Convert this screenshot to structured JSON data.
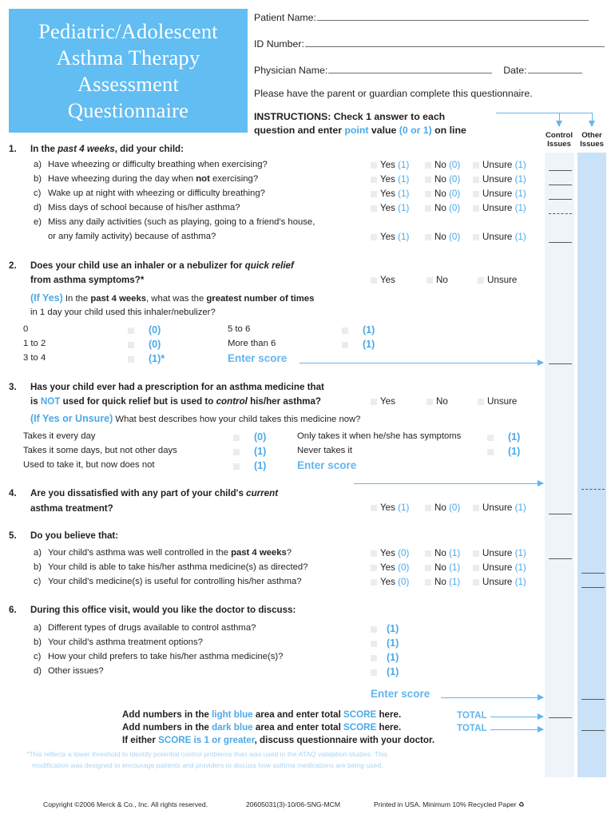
{
  "title_banner": {
    "lines": [
      "Pediatric/Adolescent",
      "Asthma Therapy",
      "Assessment",
      "Questionnaire"
    ],
    "bg_color": "#61bdf2"
  },
  "header": {
    "patient_name_label": "Patient Name:",
    "id_number_label": "ID Number:",
    "physician_name_label": "Physician Name:",
    "date_label": "Date:",
    "parent_note": "Please have the parent or guardian complete this questionnaire.",
    "instructions_line1_a": "INSTRUCTIONS:  Check 1 answer to each",
    "instructions_line2_a": "question and enter ",
    "instructions_point": "point",
    "instructions_line2_b": " value ",
    "instructions_range": "(0 or 1)",
    "instructions_line2_c": " on line"
  },
  "columns": {
    "control_issues": "Control\nIssues",
    "control_issues_l1": "Control",
    "control_issues_l2": "Issues",
    "other_issues_l1": "Other",
    "other_issues_l2": "Issues",
    "control_color": "#eef4f9",
    "other_color": "#c9e2f7"
  },
  "answers": {
    "yes": "Yes",
    "no": "No",
    "unsure": "Unsure",
    "p1": "(1)",
    "p0": "(0)"
  },
  "q1": {
    "number": "1.",
    "stem_a": "In the ",
    "stem_i": "past 4 weeks",
    "stem_b": ", did your child:",
    "items": [
      {
        "letter": "a)",
        "text_pre": "Have wheezing or difficulty breathing when exercising?",
        "yes": "(1)",
        "no": "(0)",
        "unsure": "(1)"
      },
      {
        "letter": "b)",
        "text_pre": "Have wheezing during the day when ",
        "bold": "not",
        "text_post": " exercising?",
        "yes": "(1)",
        "no": "(0)",
        "unsure": "(1)"
      },
      {
        "letter": "c)",
        "text_pre": "Wake up at night with wheezing or difficulty breathing?",
        "yes": "(1)",
        "no": "(0)",
        "unsure": "(1)"
      },
      {
        "letter": "d)",
        "text_pre": "Miss days of school because of his/her asthma?",
        "yes": "(1)",
        "no": "(0)",
        "unsure": "(1)"
      },
      {
        "letter": "e)",
        "text_pre": "Miss any daily activities (such as playing, going to a friend's house,",
        "line2": "or any family activity) because of asthma?",
        "yes": "(1)",
        "no": "(0)",
        "unsure": "(1)"
      }
    ]
  },
  "q2": {
    "number": "2.",
    "line1_a": "Does your child use an inhaler or a nebulizer for ",
    "line1_i": "quick relief",
    "line2": "from asthma symptoms?*",
    "if_yes": "(If Yes)",
    "sub_a": " In the ",
    "sub_b": "past 4 weeks",
    "sub_c": ", what was the ",
    "sub_d": "greatest number of times",
    "sub_line2": "in 1 day your child used this inhaler/nebulizer?",
    "options_left": [
      {
        "label": "0",
        "value": "(0)"
      },
      {
        "label": "1 to 2",
        "value": "(0)"
      },
      {
        "label": "3 to 4",
        "value": "(1)*"
      }
    ],
    "options_right": [
      {
        "label": "5 to 6",
        "value": "(1)"
      },
      {
        "label": "More than 6",
        "value": "(1)"
      }
    ],
    "enter_score": "Enter score"
  },
  "q3": {
    "number": "3.",
    "line1": "Has your child ever had a prescription for an asthma medicine that",
    "line2_a": "is ",
    "line2_not": "NOT",
    "line2_b": " used for quick relief but is used to ",
    "line2_i": "control",
    "line2_c": " his/her asthma?",
    "if_yes_unsure": "(If Yes or Unsure)",
    "sub": " What best describes how your child takes this medicine now?",
    "options_left": [
      {
        "label": "Takes it every day",
        "value": "(0)"
      },
      {
        "label": "Takes it some days, but not other days",
        "value": "(1)"
      },
      {
        "label": "Used to take it, but now does not",
        "value": "(1)"
      }
    ],
    "options_right": [
      {
        "label": "Only takes it when he/she has symptoms",
        "value": "(1)"
      },
      {
        "label": "Never takes it",
        "value": "(1)"
      }
    ],
    "enter_score": "Enter score"
  },
  "q4": {
    "number": "4.",
    "line1_a": "Are you dissatisfied with any part of your child's ",
    "line1_i": "current",
    "line2": "asthma treatment?",
    "yes": "(1)",
    "no": "(0)",
    "unsure": "(1)"
  },
  "q5": {
    "number": "5.",
    "stem": "Do you believe that:",
    "items": [
      {
        "letter": "a)",
        "text_pre": "Your child's asthma was well controlled in the ",
        "bold": "past 4 weeks",
        "text_post": "?",
        "yes": "(0)",
        "no": "(1)",
        "unsure": "(1)"
      },
      {
        "letter": "b)",
        "text_pre": "Your child is able to take his/her asthma medicine(s) as directed?",
        "yes": "(0)",
        "no": "(1)",
        "unsure": "(1)"
      },
      {
        "letter": "c)",
        "text_pre": "Your child's medicine(s) is useful for controlling his/her asthma?",
        "yes": "(0)",
        "no": "(1)",
        "unsure": "(1)"
      }
    ]
  },
  "q6": {
    "number": "6.",
    "stem": "During this office visit, would you like the doctor to discuss:",
    "items": [
      {
        "letter": "a)",
        "text": "Different types of drugs available to control asthma?",
        "value": "(1)"
      },
      {
        "letter": "b)",
        "text": "Your child's asthma treatment options?",
        "value": "(1)"
      },
      {
        "letter": "c)",
        "text": "How your child prefers to take his/her asthma medicine(s)?",
        "value": "(1)"
      },
      {
        "letter": "d)",
        "text": "Other issues?",
        "value": "(1)"
      }
    ],
    "enter_score": "Enter score"
  },
  "totals": {
    "line1_a": "Add numbers in the ",
    "line1_lightblue": "light blue",
    "line1_b": " area and enter total ",
    "line1_score": "SCORE",
    "line1_c": " here.",
    "line2_a": "Add numbers in the ",
    "line2_darkblue": "dark blue",
    "line2_b": " area and enter total ",
    "line2_score": "SCORE",
    "line2_c": " here.",
    "line3_a": "If either ",
    "line3_score": "SCORE is 1 or greater",
    "line3_b": ", discuss questionnaire with your doctor.",
    "total_label": "TOTAL"
  },
  "footnote": {
    "line1": "*This reflects a lower threshold to identify potential control problems than was used in the ATAQ validation studies. This",
    "line2": "modification was designed to encourage patients and providers to discuss how asthma medications are being used."
  },
  "footer": {
    "copyright": "Copyright ©2006 Merck & Co., Inc.  All rights reserved.",
    "code": "20605031(3)-10/06-SNG-MCM",
    "printed": "Printed in USA.  Minimum 10% Recycled Paper ♻"
  }
}
